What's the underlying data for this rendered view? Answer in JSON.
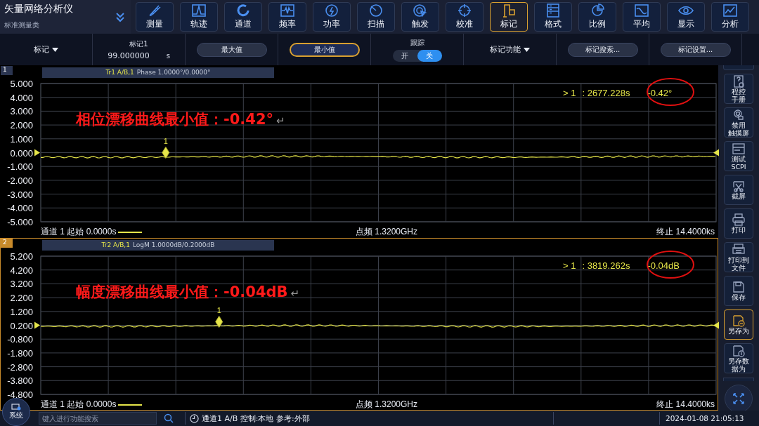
{
  "header": {
    "title": "矢量网络分析仪",
    "subtitle": "标准测量类"
  },
  "toolbar": [
    {
      "label": "测量",
      "kind": "ruler",
      "selected": false
    },
    {
      "label": "轨迹",
      "kind": "trace",
      "selected": false
    },
    {
      "label": "通道",
      "kind": "channel",
      "selected": false
    },
    {
      "label": "频率",
      "kind": "frequency",
      "selected": false
    },
    {
      "label": "功率",
      "kind": "power",
      "selected": false
    },
    {
      "label": "扫描",
      "kind": "sweep",
      "selected": false
    },
    {
      "label": "触发",
      "kind": "trigger",
      "selected": false
    },
    {
      "label": "校准",
      "kind": "calibrate",
      "selected": false
    },
    {
      "label": "标记",
      "kind": "marker",
      "selected": true
    },
    {
      "label": "格式",
      "kind": "format",
      "selected": false
    },
    {
      "label": "比例",
      "kind": "scale",
      "selected": false
    },
    {
      "label": "平均",
      "kind": "average",
      "selected": false
    },
    {
      "label": "显示",
      "kind": "display",
      "selected": false
    },
    {
      "label": "分析",
      "kind": "analysis",
      "selected": false
    }
  ],
  "marker_bar": {
    "marker_dropdown": "标记",
    "marker_name": "标记1",
    "marker_value": "99.000000",
    "marker_unit": "s",
    "search_buttons": [
      {
        "label": "最大值",
        "selected": false
      },
      {
        "label": "最小值",
        "selected": true
      }
    ],
    "tracking": {
      "label": "跟踪",
      "options": [
        {
          "label": "开",
          "selected": false
        },
        {
          "label": "关",
          "selected": true
        }
      ]
    },
    "function_dropdown": "标记功能",
    "buttons": [
      "标记搜索...",
      "标记设置..."
    ]
  },
  "panes": [
    {
      "number": "1",
      "active": false,
      "trace_name": "Tr1 A/B,1",
      "trace_info": "Phase 1.0000°/0.0000°",
      "y_axis_labels": [
        "5.000",
        "4.000",
        "3.000",
        "2.000",
        "1.000",
        "0.000",
        "-1.000",
        "-2.000",
        "-3.000",
        "-4.000",
        "-5.000"
      ],
      "marker_label": "1",
      "readout": {
        "marker": "> 1",
        "stimulus": ": 2677.228s",
        "value": "-0.42°"
      },
      "note": {
        "text": "相位漂移曲线最小值：-0.42°",
        "return_mark": "↵"
      },
      "footer": {
        "start": "通道 1 起始 0.0000s",
        "center": "点频 1.3200GHz",
        "stop": "终止 14.4000ks"
      }
    },
    {
      "number": "2",
      "active": true,
      "trace_name": "Tr2 A/B,1",
      "trace_info": "LogM 1.0000dB/0.2000dB",
      "y_axis_labels": [
        "5.200",
        "4.200",
        "3.200",
        "2.200",
        "1.200",
        "0.200",
        "-0.800",
        "-1.800",
        "-2.800",
        "-3.800",
        "-4.800"
      ],
      "marker_label": "1",
      "readout": {
        "marker": "> 1",
        "stimulus": ": 3819.262s",
        "value": "-0.04dB"
      },
      "note": {
        "text": "幅度漂移曲线最小值：-0.04dB",
        "return_mark": "↵"
      },
      "footer": {
        "start": "通道 1 起始 0.0000s",
        "center": "点频 1.3200GHz",
        "stop": "终止 14.4000ks"
      }
    }
  ],
  "side_buttons": [
    {
      "lines": [
        "程控",
        "手册"
      ],
      "kind": "manual",
      "selected": false
    },
    {
      "lines": [
        "禁用",
        "触摸屏"
      ],
      "kind": "touch",
      "selected": false
    },
    {
      "lines": [
        "测试",
        "SCPI"
      ],
      "kind": "scpi",
      "selected": false
    },
    {
      "lines": [
        "截屏"
      ],
      "kind": "screenshot",
      "selected": false
    },
    {
      "lines": [
        "打印"
      ],
      "kind": "print",
      "selected": false
    },
    {
      "lines": [
        "打印到",
        "文件"
      ],
      "kind": "print-file",
      "selected": false
    },
    {
      "lines": [
        "保存"
      ],
      "kind": "save",
      "selected": false
    },
    {
      "lines": [
        "另存为"
      ],
      "kind": "save-as",
      "selected": true
    },
    {
      "lines": [
        "另存数",
        "据为"
      ],
      "kind": "save-data",
      "selected": false
    }
  ],
  "status_bar": {
    "system_button": "系统",
    "search": {
      "placeholder": "键入进行功能搜索"
    },
    "channel_info": "通道1 A/B 控制:本地 参考:外部",
    "datetime": "2024-01-08 21:05:13"
  }
}
